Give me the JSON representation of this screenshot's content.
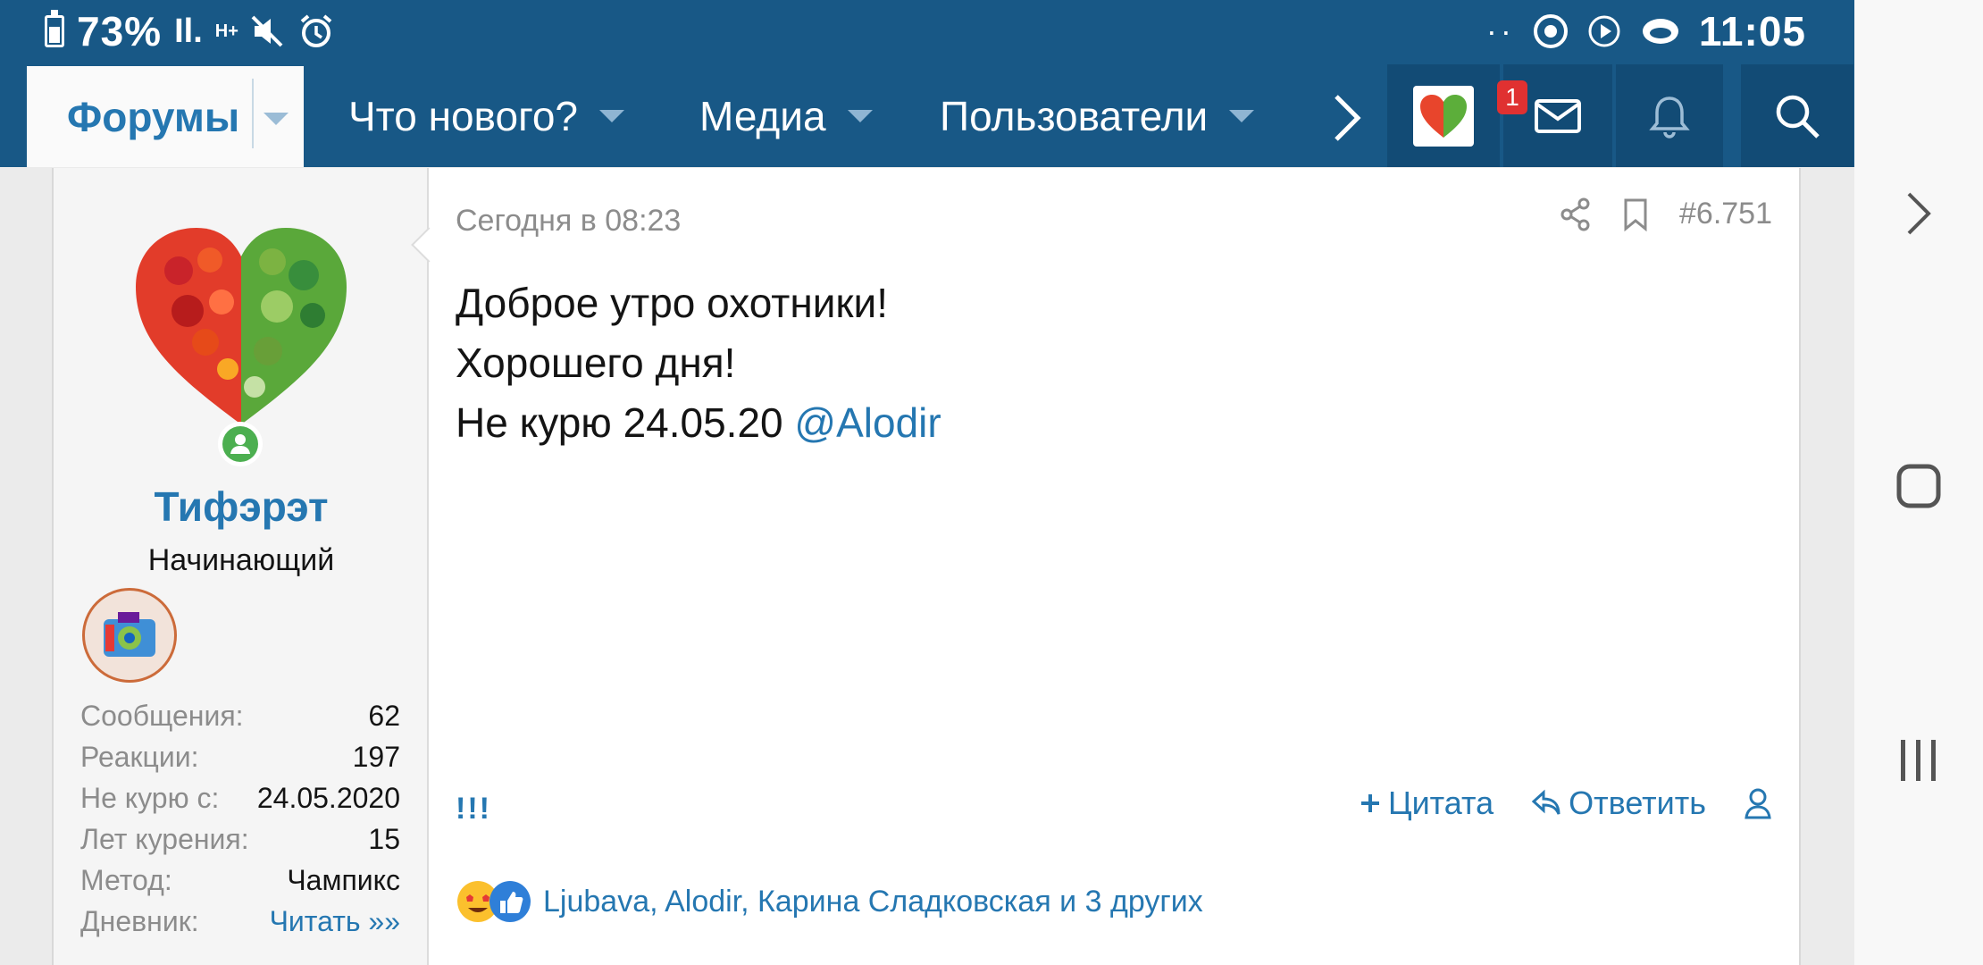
{
  "status_bar": {
    "battery": "73%",
    "signal": "Il.",
    "network": "H+",
    "time": "11:05"
  },
  "nav": {
    "forums": "Форумы",
    "whats_new": "Что нового?",
    "media": "Медиа",
    "members": "Пользователи",
    "inbox_badge": "1"
  },
  "user": {
    "name": "Тифэрэт",
    "title": "Начинающий",
    "stats": [
      {
        "label": "Сообщения:",
        "value": "62"
      },
      {
        "label": "Реакции:",
        "value": "197"
      },
      {
        "label": "Не курю с:",
        "value": "24.05.2020"
      },
      {
        "label": "Лет курения:",
        "value": "15"
      },
      {
        "label": "Метод:",
        "value": "Чампикс"
      },
      {
        "label": "Дневник:",
        "value": "Читать »»"
      }
    ]
  },
  "post": {
    "date": "Сегодня в 08:23",
    "number": "#6.751",
    "line1": "Доброе утро охотники!",
    "line2": "Хорошего дня!",
    "line3": "Не курю 24.05.20",
    "mention": "@Alodir",
    "bang": "!!!",
    "quote_label": "Цитата",
    "reply_label": "Ответить",
    "reactions_text": "Ljubava, Alodir, Карина Сладковская и 3 других"
  },
  "colors": {
    "header": "#185886",
    "accent": "#2577b1",
    "online": "#4caf50",
    "badge": "#e03131"
  }
}
